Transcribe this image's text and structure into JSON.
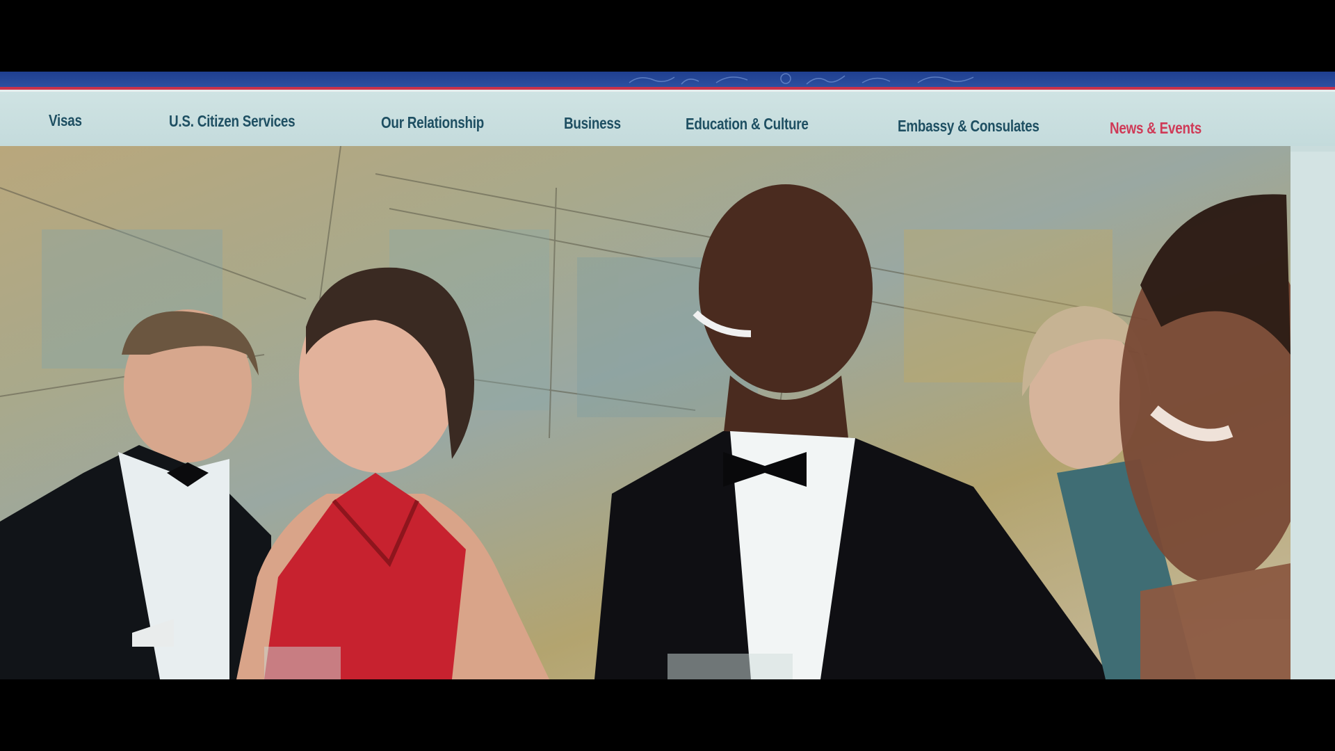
{
  "nav": {
    "items": [
      {
        "label": "Visas",
        "active": false
      },
      {
        "label": "U.S. Citizen Services",
        "active": false
      },
      {
        "label": "Our Relationship",
        "active": false
      },
      {
        "label": "Business",
        "active": false
      },
      {
        "label": "Education & Culture",
        "active": false
      },
      {
        "label": "Embassy & Consulates",
        "active": false
      },
      {
        "label": "News & Events",
        "active": true
      }
    ]
  },
  "colors": {
    "header_blue": "#2b4fa0",
    "header_red": "#c8324b",
    "nav_text": "#1e4f62",
    "nav_active": "#cf3a57"
  },
  "icons": {
    "header": "seal-icon"
  }
}
